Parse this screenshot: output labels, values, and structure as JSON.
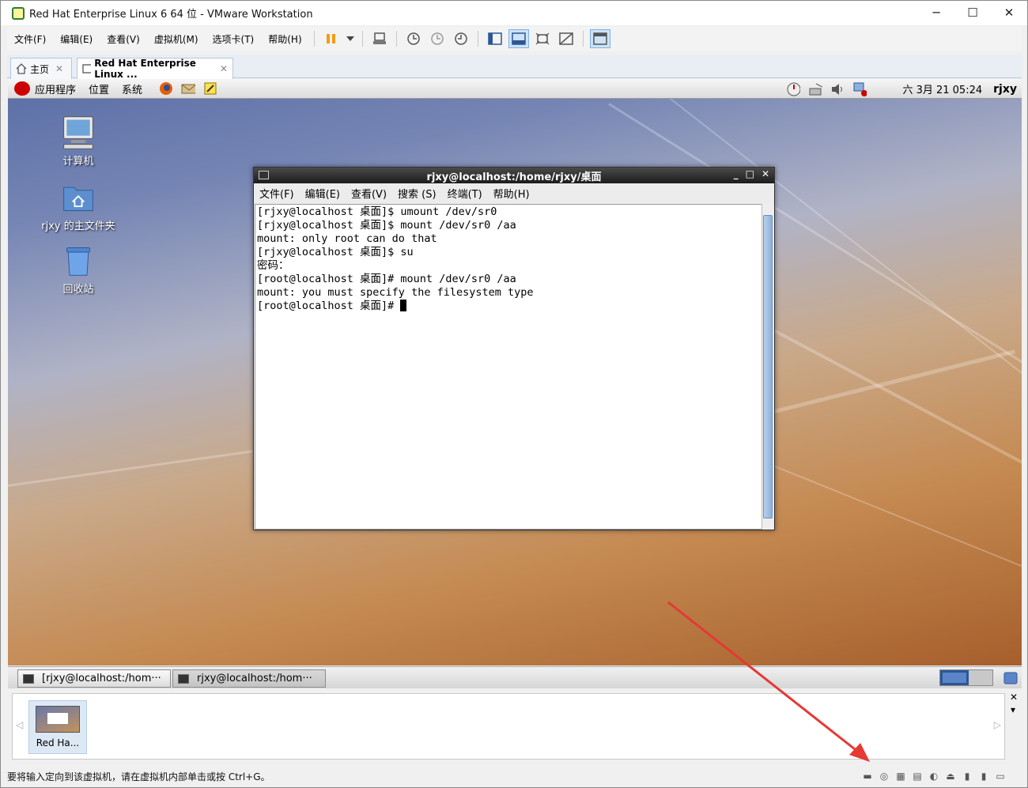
{
  "window": {
    "title": "Red Hat Enterprise Linux 6 64 位 - VMware Workstation",
    "minimize": "─",
    "maximize": "☐",
    "close": "✕"
  },
  "menubar": {
    "items": [
      "文件(F)",
      "编辑(E)",
      "查看(V)",
      "虚拟机(M)",
      "选项卡(T)",
      "帮助(H)"
    ]
  },
  "tabs": [
    {
      "label": "主页",
      "close": "✕"
    },
    {
      "label": "Red Hat Enterprise Linux ...",
      "close": "✕"
    }
  ],
  "gnome_panel": {
    "menus": [
      "应用程序",
      "位置",
      "系统"
    ],
    "clock": "六 3月 21 05:24",
    "user": "rjxy"
  },
  "desktop_icons": [
    {
      "label": "计算机",
      "icon": "computer-icon"
    },
    {
      "label": "rjxy 的主文件夹",
      "icon": "home-folder-icon"
    },
    {
      "label": "回收站",
      "icon": "trash-icon"
    }
  ],
  "terminal": {
    "title": "rjxy@localhost:/home/rjxy/桌面",
    "menus": [
      "文件(F)",
      "编辑(E)",
      "查看(V)",
      "搜索 (S)",
      "终端(T)",
      "帮助(H)"
    ],
    "lines": [
      "[rjxy@localhost 桌面]$ umount /dev/sr0",
      "[rjxy@localhost 桌面]$ mount /dev/sr0 /aa",
      "mount: only root can do that",
      "[rjxy@localhost 桌面]$ su",
      "密码：",
      "[root@localhost 桌面]# mount /dev/sr0 /aa",
      "mount: you must specify the filesystem type",
      "[root@localhost 桌面]# "
    ]
  },
  "taskbar": {
    "items": [
      "[rjxy@localhost:/hom···",
      "rjxy@localhost:/hom···"
    ]
  },
  "thumbnail": {
    "label": "Red Ha...",
    "close": "✕",
    "dropdown": "▾"
  },
  "statusbar": {
    "message": "要将输入定向到该虚拟机，请在虚拟机内部单击或按 Ctrl+G。"
  },
  "colors": {
    "annotation_arrow": "#e53935",
    "toolbar_accent": "#f39c12"
  }
}
